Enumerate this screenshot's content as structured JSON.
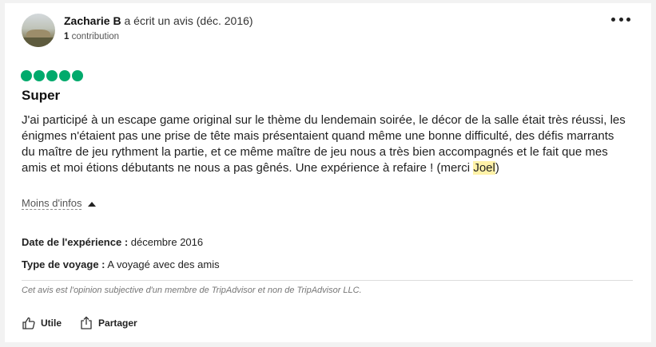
{
  "review": {
    "author_name": "Zacharie B",
    "author_action": " a écrit un avis (déc. 2016)",
    "contributions_count": "1",
    "contributions_label": " contribution",
    "rating": 5,
    "rating_color": "#00aa6c",
    "title": "Super",
    "body_before": "J'ai participé à un escape game original sur le thème du lendemain soirée, le décor de la salle était très réussi, les énigmes n'étaient pas une prise de tête mais présentaient quand même une bonne difficulté, des défis marrants du maître de jeu rythment la partie, et ce même maître de jeu nous a très bien accompagnés et le fait que mes amis et moi étions débutants ne nous a pas gênés. Une expérience à refaire ! (merci ",
    "body_highlight": "Joel",
    "body_after": ")",
    "less_info_label": "Moins d'infos",
    "date_label": "Date de l'expérience :",
    "date_value": " décembre 2016",
    "trip_type_label": "Type de voyage :",
    "trip_type_value": " A voyagé avec des amis",
    "disclaimer": "Cet avis est l'opinion subjective d'un membre de TripAdvisor et non de TripAdvisor LLC.",
    "actions": {
      "helpful_label": "Utile",
      "share_label": "Partager"
    }
  }
}
